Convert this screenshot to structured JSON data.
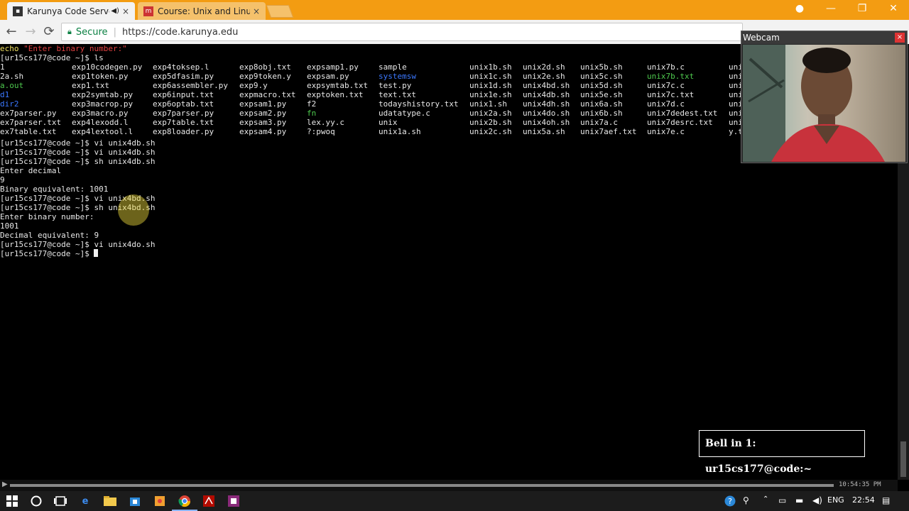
{
  "browser": {
    "tabs": [
      {
        "title": "Karunya Code Server",
        "audio_icon": "speaker-icon",
        "close": "×",
        "active": true
      },
      {
        "title": "Course: Unix and Linux Le",
        "close": "×",
        "active": false
      }
    ],
    "window_controls": {
      "minimize": "—",
      "maximize": "❐",
      "close": "✕"
    },
    "profile_icon": "person-icon",
    "nav": {
      "back": "←",
      "forward": "→",
      "reload": "⟳"
    },
    "omnibox": {
      "secure_label": "Secure",
      "separator": "|",
      "url": "https://code.karunya.edu"
    }
  },
  "terminal": {
    "top_line": {
      "prefix": "echo ",
      "text": "\"Enter binary number:\""
    },
    "prompt_ls": "[ur15cs177@code ~]$ ls",
    "ls_columns": [
      {
        "items": [
          {
            "t": "1"
          },
          {
            "t": "2a.sh"
          },
          {
            "t": "a.out",
            "c": "green"
          },
          {
            "t": "d1",
            "c": "blue"
          },
          {
            "t": "dir2",
            "c": "blue"
          },
          {
            "t": "ex7parser.py"
          },
          {
            "t": "ex7parser.txt"
          },
          {
            "t": "ex7table.txt"
          }
        ]
      },
      {
        "items": [
          {
            "t": "exp10codegen.py"
          },
          {
            "t": "exp1token.py"
          },
          {
            "t": "exp1.txt"
          },
          {
            "t": "exp2symtab.py"
          },
          {
            "t": "exp3macrop.py"
          },
          {
            "t": "exp3macro.py"
          },
          {
            "t": "exp4lexodd.l"
          },
          {
            "t": "exp4lextool.l"
          }
        ]
      },
      {
        "items": [
          {
            "t": "exp4toksep.l"
          },
          {
            "t": "exp5dfasim.py"
          },
          {
            "t": "exp6assembler.py"
          },
          {
            "t": "exp6input.txt"
          },
          {
            "t": "exp6optab.txt"
          },
          {
            "t": "exp7parser.py"
          },
          {
            "t": "exp7table.txt"
          },
          {
            "t": "exp8loader.py"
          }
        ]
      },
      {
        "items": [
          {
            "t": "exp8obj.txt"
          },
          {
            "t": "exp9token.y"
          },
          {
            "t": "exp9.y"
          },
          {
            "t": "expmacro.txt"
          },
          {
            "t": "expsam1.py"
          },
          {
            "t": "expsam2.py"
          },
          {
            "t": "expsam3.py"
          },
          {
            "t": "expsam4.py"
          }
        ]
      },
      {
        "items": [
          {
            "t": "expsamp1.py"
          },
          {
            "t": "expsam.py"
          },
          {
            "t": "expsymtab.txt"
          },
          {
            "t": "exptoken.txt"
          },
          {
            "t": "f2"
          },
          {
            "t": "fn",
            "c": "green"
          },
          {
            "t": "lex.yy.c"
          },
          {
            "t": "?:pwoq"
          }
        ]
      },
      {
        "items": [
          {
            "t": "sample"
          },
          {
            "t": "systemsw",
            "c": "blue"
          },
          {
            "t": "test.py"
          },
          {
            "t": "text.txt"
          },
          {
            "t": "todayshistory.txt"
          },
          {
            "t": "udatatype.c"
          },
          {
            "t": "unix"
          },
          {
            "t": "unix1a.sh"
          }
        ]
      },
      {
        "items": [
          {
            "t": "unix1b.sh"
          },
          {
            "t": "unix1c.sh"
          },
          {
            "t": "unix1d.sh"
          },
          {
            "t": "unix1e.sh"
          },
          {
            "t": "unix1.sh"
          },
          {
            "t": "unix2a.sh"
          },
          {
            "t": "unix2b.sh"
          },
          {
            "t": "unix2c.sh"
          }
        ]
      },
      {
        "items": [
          {
            "t": "unix2d.sh"
          },
          {
            "t": "unix2e.sh"
          },
          {
            "t": "unix4bd.sh"
          },
          {
            "t": "unix4db.sh"
          },
          {
            "t": "unix4dh.sh"
          },
          {
            "t": "unix4do.sh"
          },
          {
            "t": "unix4oh.sh"
          },
          {
            "t": "unix5a.sh"
          }
        ]
      },
      {
        "items": [
          {
            "t": "unix5b.sh"
          },
          {
            "t": "unix5c.sh"
          },
          {
            "t": "unix5d.sh"
          },
          {
            "t": "unix5e.sh"
          },
          {
            "t": "unix6a.sh"
          },
          {
            "t": "unix6b.sh"
          },
          {
            "t": "unix7a.c"
          },
          {
            "t": "unix7aef.txt"
          }
        ]
      },
      {
        "items": [
          {
            "t": "unix7b.c"
          },
          {
            "t": "unix7b.txt",
            "c": "green"
          },
          {
            "t": "unix7c.c"
          },
          {
            "t": "unix7c.txt"
          },
          {
            "t": "unix7d.c"
          },
          {
            "t": "unix7dedest.txt"
          },
          {
            "t": "unix7desrc.txt"
          },
          {
            "t": "unix7e.c"
          }
        ]
      },
      {
        "items": [
          {
            "t": "uni"
          },
          {
            "t": "uni"
          },
          {
            "t": "uni"
          },
          {
            "t": "uni"
          },
          {
            "t": "uni"
          },
          {
            "t": "uni"
          },
          {
            "t": "uni"
          },
          {
            "t": "y.t"
          }
        ]
      }
    ],
    "lines": [
      "[ur15cs177@code ~]$ vi unix4db.sh",
      "[ur15cs177@code ~]$ vi unix4db.sh",
      "[ur15cs177@code ~]$ sh unix4db.sh",
      "Enter decimal",
      "9",
      "Binary equivalent: 1001",
      "[ur15cs177@code ~]$ vi unix4bd.sh",
      "[ur15cs177@code ~]$ sh unix4bd.sh",
      "Enter binary number:",
      "1001",
      "Decimal equivalent: 9",
      "[ur15cs177@code ~]$ vi unix4do.sh"
    ],
    "final_prompt": "[ur15cs177@code ~]$ ",
    "scroll_arrow": "▶",
    "timestamp": "10:54:35 PM"
  },
  "webcam": {
    "title": "Webcam",
    "close": "×"
  },
  "notification": {
    "text": "Bell in 1: ur15cs177@code:~"
  },
  "taskbar": {
    "start_icon": "windows-icon",
    "tray": {
      "lang": "ENG",
      "clock": "22:54"
    }
  },
  "colors": {
    "tab_strip": "#f39c12",
    "terminal_bg": "#000000",
    "dir_blue": "#3b78ff",
    "exec_green": "#4ec94e"
  }
}
